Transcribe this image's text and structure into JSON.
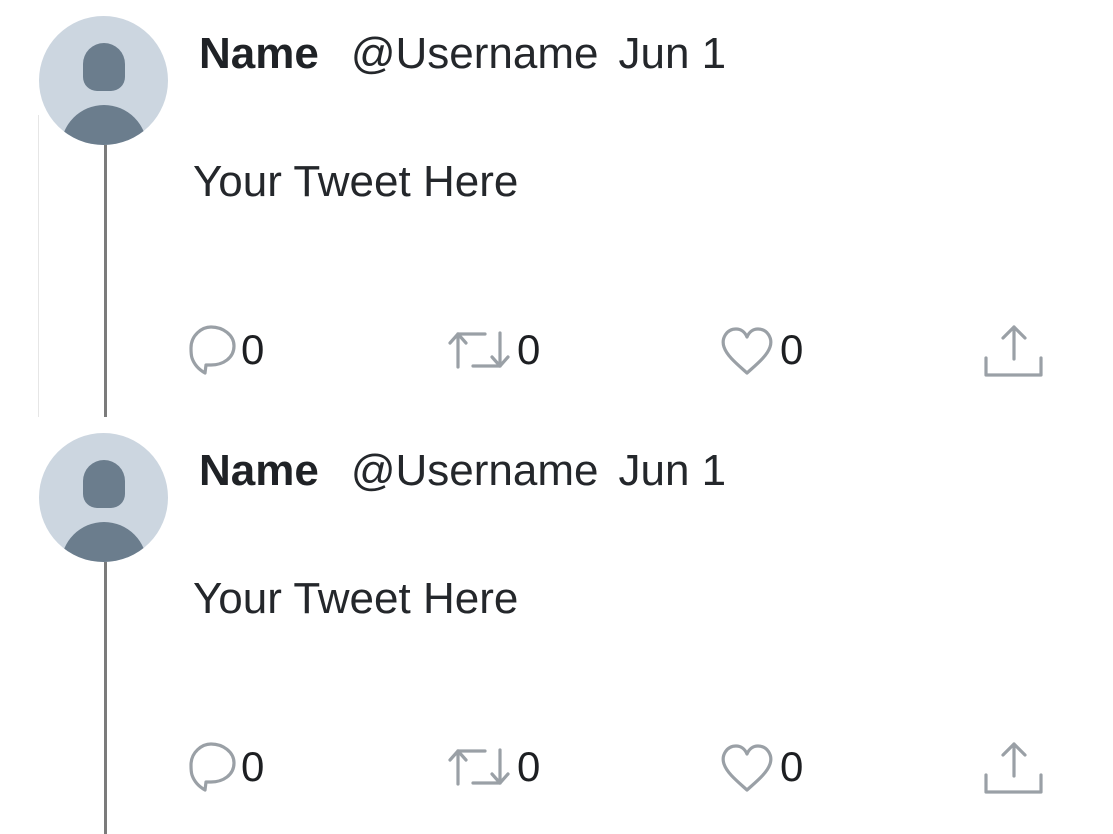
{
  "tweets": [
    {
      "name": "Name",
      "username": "@Username",
      "date": "Jun 1",
      "text": "Your Tweet Here",
      "reply_count": "0",
      "retweet_count": "0",
      "like_count": "0",
      "icons": {
        "avatar": "default-avatar",
        "reply": "reply-icon",
        "retweet": "retweet-icon",
        "like": "heart-icon",
        "share": "share-icon"
      }
    },
    {
      "name": "Name",
      "username": "@Username",
      "date": "Jun 1",
      "text": "Your Tweet Here",
      "reply_count": "0",
      "retweet_count": "0",
      "like_count": "0",
      "icons": {
        "avatar": "default-avatar",
        "reply": "reply-icon",
        "retweet": "retweet-icon",
        "like": "heart-icon",
        "share": "share-icon"
      }
    }
  ],
  "colors": {
    "avatar_background": "#ccd6e0",
    "avatar_figure": "#6b7d8d",
    "thread_line": "#7b7b7b",
    "icon_gray": "#9aa0a6",
    "text": "#24272b"
  }
}
